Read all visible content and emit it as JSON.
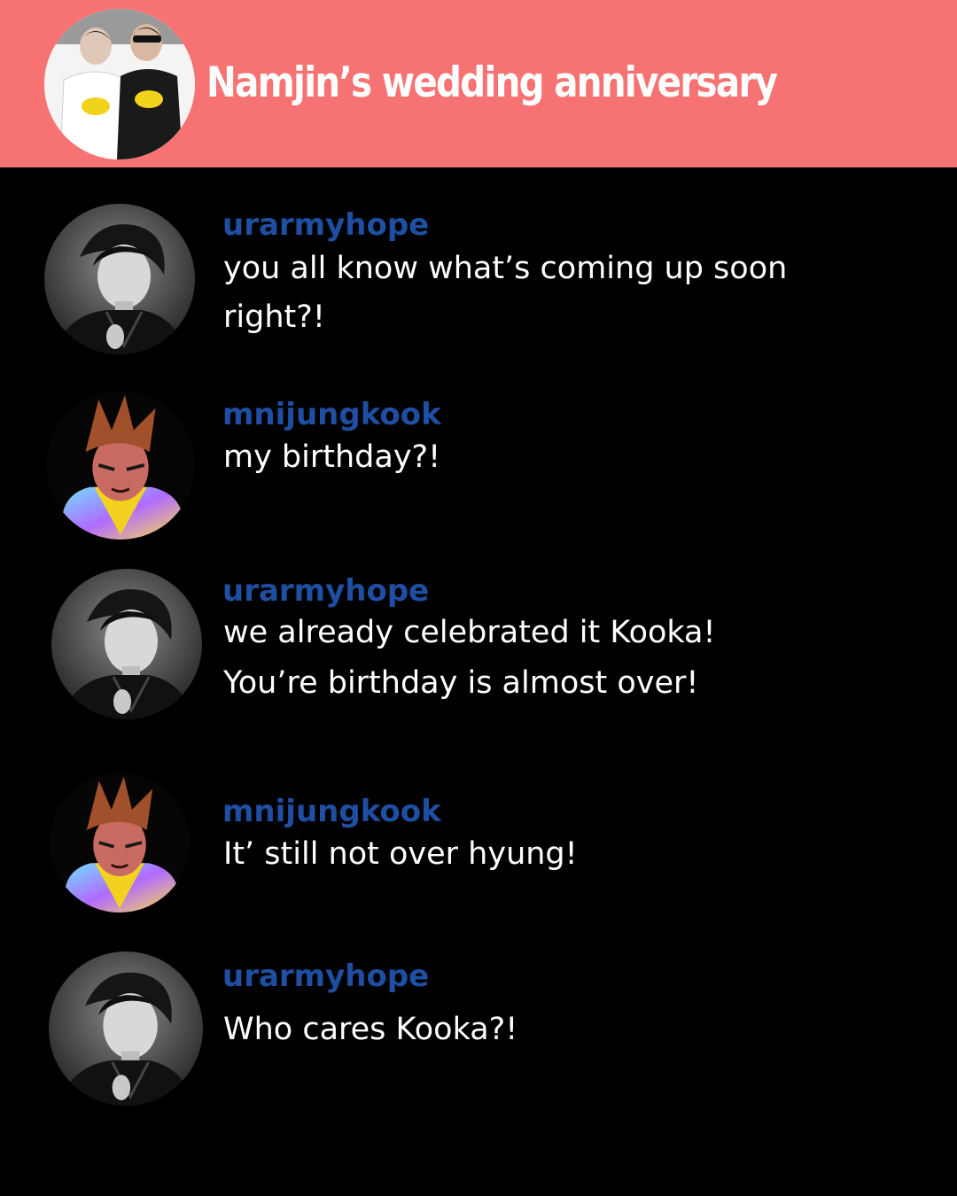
{
  "header": {
    "title": "Namjin’s wedding anniversary",
    "background_color": "#f77272",
    "avatar_icon": "group-photo-avatar"
  },
  "colors": {
    "username": "#1e4fa3",
    "message_text": "#ffffff",
    "background": "#000000"
  },
  "messages": [
    {
      "username": "urarmyhope",
      "avatar": "grayscale-portrait-avatar",
      "text": "you all know what’s coming up soon right?!"
    },
    {
      "username": "mnijungkook",
      "avatar": "anime-character-avatar",
      "text": "my birthday?!"
    },
    {
      "username": "urarmyhope",
      "avatar": "grayscale-portrait-avatar",
      "lines": [
        "we already celebrated it Kooka!",
        "You’re birthday is almost over!"
      ]
    },
    {
      "username": "mnijungkook",
      "avatar": "anime-character-avatar",
      "text": "It’ still not over hyung!"
    },
    {
      "username": "urarmyhope",
      "avatar": "grayscale-portrait-avatar",
      "text": "Who cares Kooka?!"
    }
  ]
}
